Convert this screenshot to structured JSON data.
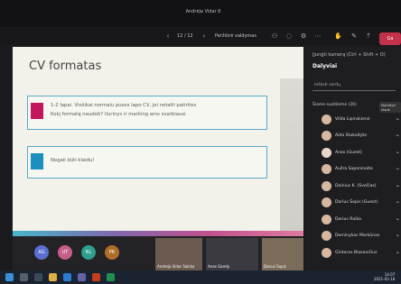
{
  "window": {
    "title": "Andrėja Vidar 8"
  },
  "toolbar": {
    "page_counter": "12 / 12",
    "present_label": "Peržiūrė valdymas",
    "leave_label": "Ga"
  },
  "slide": {
    "title": "CV formatas",
    "box1_line1": "1-2 lapai. Viešikai normalu puses lapo CV, jei netaiti patirties",
    "box1_line2": "Kokį formatą naudoti? Ilurinys ir marking ams svarbiausi",
    "box2_text": "Negali būti klaidu!",
    "colors": {
      "box1_marker": "#c2185b",
      "box2_marker": "#1a8fc0",
      "border": "#58a9c9"
    }
  },
  "panel": {
    "header": "Įjungti kamerą (Ctrl + Shift + O)",
    "title": "Dalyviai",
    "search_placeholder": "Ieškoti vardų",
    "section": "Šiame susitikime (26)",
    "mute_all": "Nutildyti visus",
    "participants": [
      {
        "name": "Vilda Lipinskienė"
      },
      {
        "name": "Aida Stukaityte"
      },
      {
        "name": "Anas (Guest)"
      },
      {
        "name": "Aušra Saponinaite"
      },
      {
        "name": "Dainius K. (Svečias)"
      },
      {
        "name": "Darius Šopis (Guest)"
      },
      {
        "name": "Darius Raika"
      },
      {
        "name": "Dominykas Markūnas"
      },
      {
        "name": "Gintaras Blasavičius"
      }
    ]
  },
  "strip": {
    "circles": [
      "AG",
      "UT",
      "NL",
      "PK"
    ],
    "tiles": [
      "Andreja Vidar Salcka",
      "Anas Gandy",
      "Darius Sopis"
    ]
  },
  "taskbar": {
    "time": "14:07",
    "date": "2021-02-18"
  }
}
